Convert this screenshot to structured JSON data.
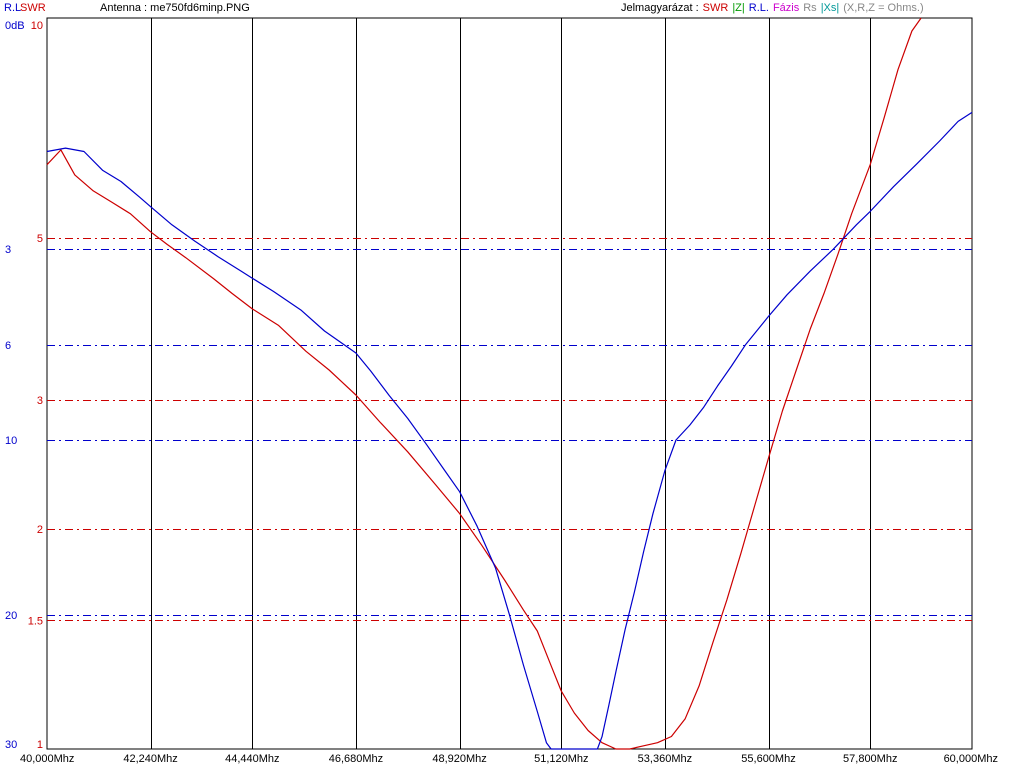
{
  "header": {
    "rl_axis_label": "R.L",
    "swr_axis_label": "SWR",
    "antenna_text": "Antenna : me750fd6minp.PNG",
    "legend_title": "Jelmagyarázat :",
    "legend_items": [
      {
        "label": "SWR",
        "color": "#cc0000"
      },
      {
        "label": "|Z|",
        "color": "#009900"
      },
      {
        "label": "R.L.",
        "color": "#0000cc"
      },
      {
        "label": "Fázis",
        "color": "#cc00cc"
      },
      {
        "label": "Rs",
        "color": "#888888"
      },
      {
        "label": "|Xs|",
        "color": "#009999"
      },
      {
        "label": "(X,R,Z = Ohms.)",
        "color": "#888888"
      }
    ]
  },
  "chart_data": {
    "type": "line",
    "xlabel": "",
    "x_range": [
      40.0,
      60.0
    ],
    "x_ticks": [
      {
        "value": 40.0,
        "label": "40,000Mhz"
      },
      {
        "value": 42.24,
        "label": "42,240Mhz"
      },
      {
        "value": 44.44,
        "label": "44,440Mhz"
      },
      {
        "value": 46.68,
        "label": "46,680Mhz"
      },
      {
        "value": 48.92,
        "label": "48,920Mhz"
      },
      {
        "value": 51.12,
        "label": "51,120Mhz"
      },
      {
        "value": 53.36,
        "label": "53,360Mhz"
      },
      {
        "value": 55.6,
        "label": "55,600Mhz"
      },
      {
        "value": 57.8,
        "label": "57,800Mhz"
      },
      {
        "value": 60.0,
        "label": "60,000Mhz"
      }
    ],
    "rl_axis": {
      "range": [
        0,
        30
      ],
      "scale": "sqrt",
      "color": "#0000cc",
      "ticks": [
        {
          "value": 0,
          "label": "0dB"
        },
        {
          "value": 3,
          "label": "3"
        },
        {
          "value": 6,
          "label": "6"
        },
        {
          "value": 10,
          "label": "10"
        },
        {
          "value": 20,
          "label": "20"
        },
        {
          "value": 30,
          "label": "30"
        }
      ],
      "gridlines": [
        3,
        6,
        10,
        20
      ]
    },
    "swr_axis": {
      "range": [
        1,
        10
      ],
      "scale": "log",
      "color": "#cc0000",
      "ticks": [
        {
          "value": 10,
          "label": "10"
        },
        {
          "value": 5,
          "label": "5"
        },
        {
          "value": 3,
          "label": "3"
        },
        {
          "value": 2,
          "label": "2"
        },
        {
          "value": 1.5,
          "label": "1.5"
        },
        {
          "value": 1,
          "label": "1"
        }
      ],
      "gridlines": [
        5,
        3,
        2,
        1.5
      ]
    },
    "grid": true,
    "series": [
      {
        "name": "SWR",
        "axis": "swr",
        "color": "#cc0000",
        "points": [
          [
            40.0,
            6.3
          ],
          [
            40.3,
            6.6
          ],
          [
            40.6,
            6.1
          ],
          [
            41.0,
            5.8
          ],
          [
            41.4,
            5.6
          ],
          [
            41.8,
            5.4
          ],
          [
            42.24,
            5.1
          ],
          [
            42.6,
            4.9
          ],
          [
            43.0,
            4.7
          ],
          [
            43.6,
            4.4
          ],
          [
            44.0,
            4.2
          ],
          [
            44.44,
            4.0
          ],
          [
            45.0,
            3.8
          ],
          [
            45.6,
            3.5
          ],
          [
            46.1,
            3.3
          ],
          [
            46.68,
            3.05
          ],
          [
            47.2,
            2.8
          ],
          [
            47.8,
            2.55
          ],
          [
            48.4,
            2.3
          ],
          [
            48.92,
            2.1
          ],
          [
            49.4,
            1.9
          ],
          [
            49.9,
            1.7
          ],
          [
            50.3,
            1.55
          ],
          [
            50.6,
            1.45
          ],
          [
            50.9,
            1.3
          ],
          [
            51.12,
            1.2
          ],
          [
            51.4,
            1.12
          ],
          [
            51.7,
            1.06
          ],
          [
            52.0,
            1.02
          ],
          [
            52.3,
            1.0
          ],
          [
            52.6,
            1.0
          ],
          [
            52.9,
            1.01
          ],
          [
            53.2,
            1.02
          ],
          [
            53.5,
            1.04
          ],
          [
            53.8,
            1.1
          ],
          [
            54.1,
            1.22
          ],
          [
            54.4,
            1.4
          ],
          [
            54.7,
            1.6
          ],
          [
            55.0,
            1.85
          ],
          [
            55.3,
            2.15
          ],
          [
            55.6,
            2.5
          ],
          [
            55.9,
            2.9
          ],
          [
            56.2,
            3.3
          ],
          [
            56.5,
            3.75
          ],
          [
            56.8,
            4.2
          ],
          [
            57.1,
            4.75
          ],
          [
            57.4,
            5.4
          ],
          [
            57.8,
            6.3
          ],
          [
            58.1,
            7.3
          ],
          [
            58.4,
            8.5
          ],
          [
            58.7,
            9.6
          ],
          [
            58.9,
            10.0
          ]
        ]
      },
      {
        "name": "R.L.",
        "axis": "rl",
        "color": "#0000cc",
        "points": [
          [
            40.0,
            1.0
          ],
          [
            40.4,
            0.95
          ],
          [
            40.8,
            1.0
          ],
          [
            41.2,
            1.3
          ],
          [
            41.6,
            1.5
          ],
          [
            42.0,
            1.8
          ],
          [
            42.24,
            2.0
          ],
          [
            42.7,
            2.4
          ],
          [
            43.2,
            2.8
          ],
          [
            43.7,
            3.2
          ],
          [
            44.2,
            3.6
          ],
          [
            44.44,
            3.8
          ],
          [
            44.9,
            4.2
          ],
          [
            45.5,
            4.8
          ],
          [
            46.0,
            5.5
          ],
          [
            46.68,
            6.3
          ],
          [
            47.0,
            7.0
          ],
          [
            47.4,
            8.0
          ],
          [
            47.8,
            9.0
          ],
          [
            48.2,
            10.2
          ],
          [
            48.6,
            11.5
          ],
          [
            48.92,
            12.6
          ],
          [
            49.3,
            14.5
          ],
          [
            49.7,
            17.0
          ],
          [
            50.0,
            20.0
          ],
          [
            50.3,
            23.5
          ],
          [
            50.6,
            27.0
          ],
          [
            50.8,
            29.5
          ],
          [
            50.9,
            30.0
          ],
          [
            51.9,
            30.0
          ],
          [
            52.0,
            29.0
          ],
          [
            52.15,
            26.5
          ],
          [
            52.3,
            24.0
          ],
          [
            52.5,
            21.0
          ],
          [
            52.7,
            18.5
          ],
          [
            52.9,
            16.0
          ],
          [
            53.1,
            13.8
          ],
          [
            53.36,
            11.5
          ],
          [
            53.6,
            10.0
          ],
          [
            53.9,
            9.3
          ],
          [
            54.2,
            8.5
          ],
          [
            54.5,
            7.6
          ],
          [
            54.8,
            6.8
          ],
          [
            55.1,
            6.0
          ],
          [
            55.6,
            5.0
          ],
          [
            56.0,
            4.3
          ],
          [
            56.5,
            3.6
          ],
          [
            57.0,
            3.0
          ],
          [
            57.5,
            2.4
          ],
          [
            57.8,
            2.1
          ],
          [
            58.3,
            1.6
          ],
          [
            58.8,
            1.2
          ],
          [
            59.3,
            0.85
          ],
          [
            59.7,
            0.6
          ],
          [
            60.0,
            0.5
          ]
        ]
      }
    ]
  }
}
